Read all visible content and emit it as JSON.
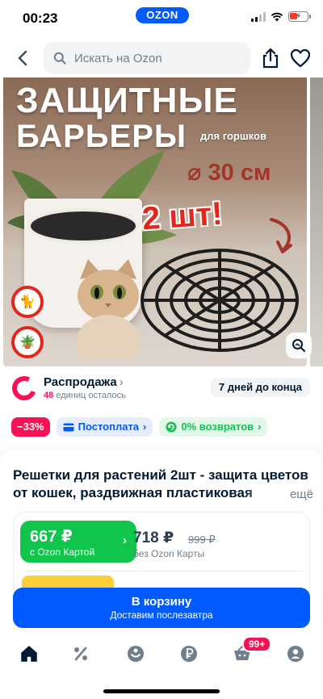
{
  "status_bar": {
    "time": "00:23",
    "app_badge": "OZON"
  },
  "search": {
    "placeholder": "Искать на Ozon"
  },
  "image_overlay": {
    "line1": "ЗАЩИТНЫЕ",
    "line2": "БАРЬЕРЫ",
    "for_pots": "для горшков",
    "diameter": "⌀ 30 см",
    "quantity": "2 шт!"
  },
  "sale": {
    "title": "Распродажа",
    "chevron": "›",
    "remaining_count": "48",
    "remaining_suffix": "единиц осталось",
    "countdown": "7 дней до конца"
  },
  "badges": {
    "discount": "−33%",
    "postpay": "Постоплата",
    "returns": "0% возвратов",
    "chevron": "›"
  },
  "product": {
    "title": "Решетки для растений 2шт - защита цветов от кошек, раздвижная пластиковая",
    "more": "ещё"
  },
  "price": {
    "ozon_card_price": "667 ₽",
    "ozon_card_label": "с Ozon Картой",
    "chevron": "›",
    "regular_price": "718 ₽",
    "old_price": "999 ₽",
    "regular_label": "без Ozon Карты"
  },
  "cart_button": {
    "label": "В корзину",
    "sublabel": "Доставим послезавтра"
  },
  "bottom_nav": {
    "cart_count": "99+"
  },
  "colors": {
    "brand_blue": "#005bff",
    "sale_pink": "#f91155",
    "ozon_green": "#10c44c"
  }
}
